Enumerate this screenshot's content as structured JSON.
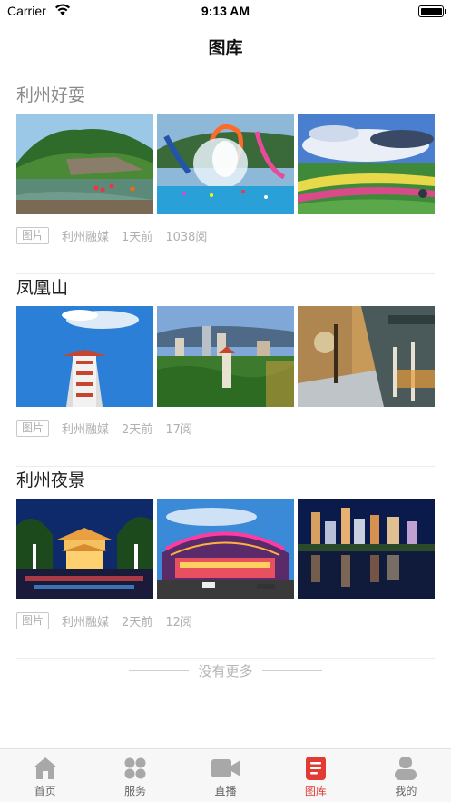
{
  "status_bar": {
    "carrier": "Carrier",
    "time": "9:13 AM"
  },
  "nav": {
    "title": "图库"
  },
  "albums": [
    {
      "title": "利州好耍",
      "tag": "图片",
      "source": "利州融媒",
      "time": "1天前",
      "reads": "1038阅"
    },
    {
      "title": "凤凰山",
      "tag": "图片",
      "source": "利州融媒",
      "time": "2天前",
      "reads": "17阅"
    },
    {
      "title": "利州夜景",
      "tag": "图片",
      "source": "利州融媒",
      "time": "2天前",
      "reads": "12阅"
    }
  ],
  "footer": {
    "no_more": "没有更多"
  },
  "tabs": [
    {
      "label": "首页",
      "icon": "home-icon"
    },
    {
      "label": "服务",
      "icon": "grid-icon"
    },
    {
      "label": "直播",
      "icon": "video-camera-icon"
    },
    {
      "label": "图库",
      "icon": "gallery-icon",
      "active": true
    },
    {
      "label": "我的",
      "icon": "person-icon"
    }
  ],
  "colors": {
    "accent": "#e23b34",
    "tab_inactive": "#a8a8a8"
  }
}
